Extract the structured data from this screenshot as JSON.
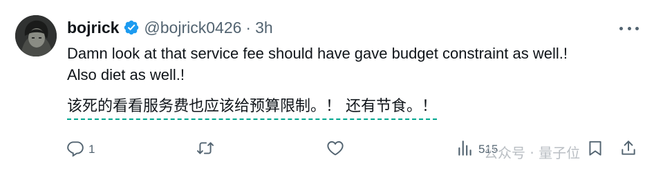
{
  "tweet": {
    "display_name": "bojrick",
    "handle": "@bojrick0426",
    "separator": "·",
    "time": "3h",
    "text_line1": "Damn look at that service fee should have gave budget constraint as well.!",
    "text_line2": "Also diet as well.!",
    "translation": "该死的看看服务费也应该给预算限制。！ 还有节食。！"
  },
  "actions": {
    "reply_count": "1",
    "retweet_count": "",
    "like_count": "",
    "views_count": "515"
  },
  "watermark": "公众号 · 量子位",
  "colors": {
    "verified_blue": "#1d9bf0",
    "secondary_text": "#536471",
    "translation_underline": "#00a58e"
  },
  "icons": [
    "verified-badge-icon",
    "more-icon",
    "reply-icon",
    "retweet-icon",
    "like-icon",
    "views-icon",
    "bookmark-icon",
    "share-icon"
  ]
}
